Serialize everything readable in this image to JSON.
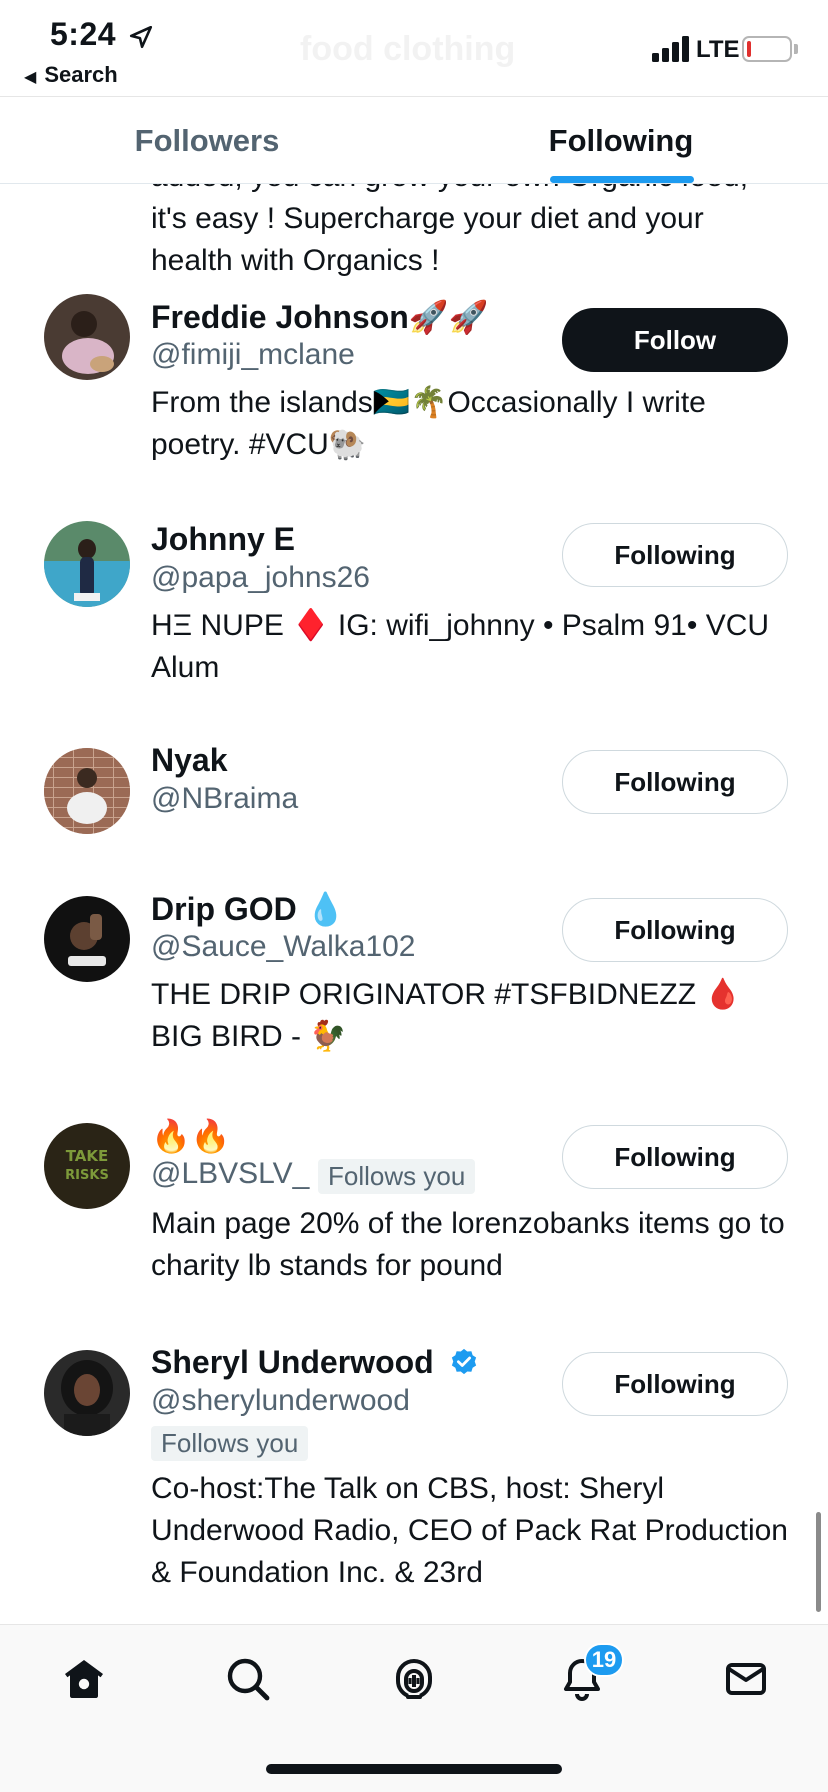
{
  "status_bar": {
    "time": "5:24",
    "back_label": "Search",
    "network": "LTE",
    "ghost_title": "food clothing"
  },
  "tabs": [
    {
      "label": "Followers",
      "active": false
    },
    {
      "label": "Following",
      "active": true
    }
  ],
  "top_bio": "added, you can grow your own Organic food, it's easy ! Supercharge your diet and your health with Organics !",
  "users": [
    {
      "name": "Freddie Johnson🚀🚀",
      "handle": "@fimiji_mclane",
      "bio": "From the islands🇧🇸🌴Occasionally I write poetry. #VCU🐏",
      "button": "Follow",
      "follows_you": false
    },
    {
      "name": "Johnny E",
      "handle": "@papa_johns26",
      "bio": "HΞ NUPE ♦️ IG: wifi_johnny • Psalm 91• VCU Alum",
      "button": "Following",
      "follows_you": false
    },
    {
      "name": "Nyak",
      "handle": "@NBraima",
      "bio": "",
      "button": "Following",
      "follows_you": false
    },
    {
      "name": "Drip GOD 💧",
      "handle": "@Sauce_Walka102",
      "bio": "THE DRIP ORIGINATOR #TSFBIDNEZZ 🩸 BIG BIRD - 🐓",
      "button": "Following",
      "follows_you": false
    },
    {
      "name": "🔥🔥",
      "handle": "@LBVSLV_",
      "bio": "Main page 20% of the lorenzobanks items go to charity lb stands for pound",
      "button": "Following",
      "follows_you": true,
      "follows_you_label": "Follows you",
      "avatar_text": "TAKE RISKS"
    },
    {
      "name": "Sheryl Underwood",
      "handle": "@sherylunderwood",
      "bio": "Co-host:The Talk on CBS, host: Sheryl Underwood Radio, CEO of Pack Rat Production & Foundation Inc. & 23rd",
      "button": "Following",
      "follows_you": true,
      "follows_you_label": "Follows you",
      "verified": true
    }
  ],
  "bottom_nav": {
    "items": [
      "home-icon",
      "search-icon",
      "spaces-icon",
      "notifications-icon",
      "messages-icon"
    ],
    "notification_count": "19"
  },
  "colors": {
    "accent": "#1d9bf0",
    "text": "#0f1419",
    "secondary": "#536471"
  }
}
